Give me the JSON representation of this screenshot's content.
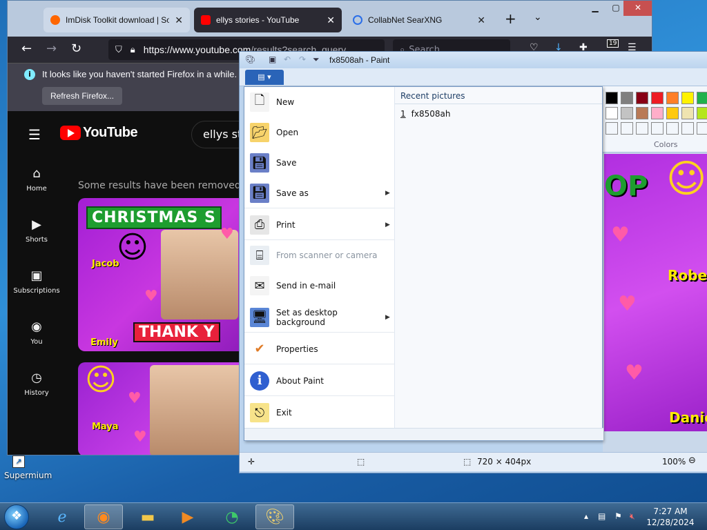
{
  "desktop": {
    "shortcut_label": "Supermium"
  },
  "firefox": {
    "tabs": [
      {
        "title": "ImDisk Toolkit download | Sourc"
      },
      {
        "title": "ellys stories - YouTube"
      },
      {
        "title": "CollabNet SearXNG"
      }
    ],
    "url_host": "https://www.youtube.com",
    "url_rest": "/results?search_query",
    "search_placeholder": "Search",
    "downloads_badge": "19",
    "notice_text": "It looks like you haven't started Firefox in a while. Do yo",
    "notice_button": "Refresh Firefox..."
  },
  "youtube": {
    "logo_text": "YouTube",
    "search_value": "ellys sto",
    "sidebar": [
      {
        "label": "Home"
      },
      {
        "label": "Shorts"
      },
      {
        "label": "Subscriptions"
      },
      {
        "label": "You"
      },
      {
        "label": "History"
      }
    ],
    "removed_notice": "Some results have been removed beca",
    "thumb1": {
      "banner": "CHRISTMAS S",
      "bottom": "THANK Y",
      "name1": "Jacob",
      "name2": "Emily"
    },
    "thumb2": {
      "name1": "Maya"
    }
  },
  "paint": {
    "title": "fx8508ah - Paint",
    "menu_items": [
      {
        "label": "New",
        "arrow": false
      },
      {
        "label": "Open",
        "arrow": false
      },
      {
        "label": "Save",
        "arrow": false
      },
      {
        "label": "Save as",
        "arrow": true
      },
      {
        "label": "Print",
        "arrow": true
      },
      {
        "label": "From scanner or camera",
        "arrow": false
      },
      {
        "label": "Send in e-mail",
        "arrow": false
      },
      {
        "label": "Set as desktop background",
        "arrow": true
      },
      {
        "label": "Properties",
        "arrow": false
      },
      {
        "label": "About Paint",
        "arrow": false
      },
      {
        "label": "Exit",
        "arrow": false
      }
    ],
    "recent_heading": "Recent pictures",
    "recent_items": [
      {
        "index": "1",
        "name": "fx8508ah"
      }
    ],
    "colors_label": "Colors",
    "canvas_text": {
      "top": "OP",
      "name1": "Rober",
      "name2": "Danie"
    },
    "status": {
      "size": "720 × 404px",
      "zoom": "100%"
    }
  },
  "taskbar": {
    "time": "7:27 AM",
    "date": "12/28/2024"
  }
}
